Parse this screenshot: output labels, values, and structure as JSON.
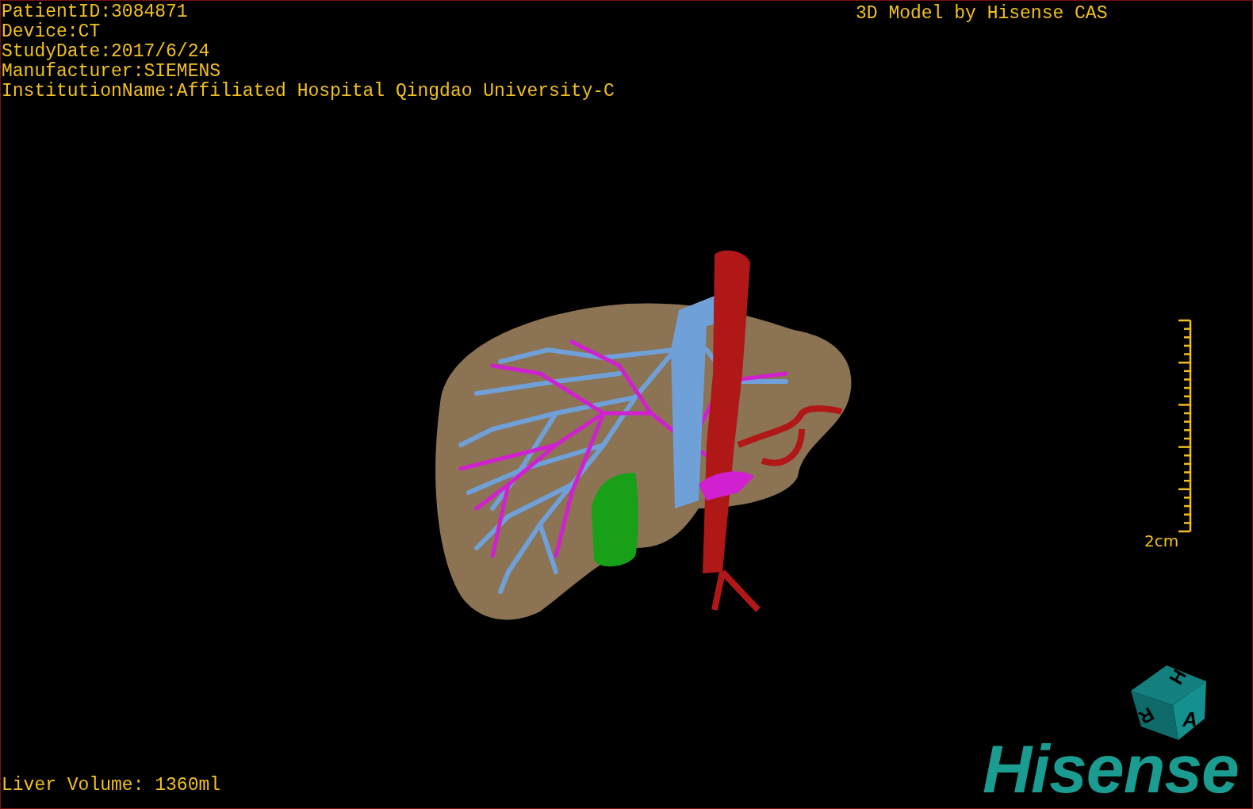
{
  "patient_info": [
    "PatientID:3084871",
    "Device:CT",
    "StudyDate:2017/6/24",
    "Manufacturer:SIEMENS",
    "InstitutionName:Affiliated Hospital Qingdao University-C"
  ],
  "model_title": "3D Model by Hisense CAS",
  "scale_bar": {
    "label": "2cm"
  },
  "orientation_cube": {
    "labels": [
      "H",
      "R",
      "A"
    ]
  },
  "logo": "Hisense",
  "liver_volume": "Liver Volume: 1360ml"
}
